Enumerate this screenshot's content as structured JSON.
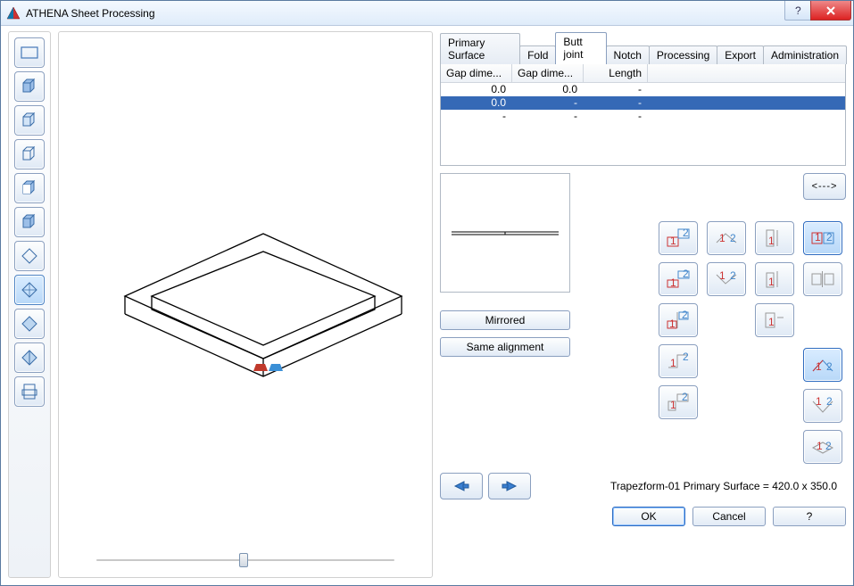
{
  "window": {
    "title": "ATHENA Sheet Processing"
  },
  "tabs": {
    "items": [
      {
        "label": "Primary Surface"
      },
      {
        "label": "Fold"
      },
      {
        "label": "Butt joint"
      },
      {
        "label": "Notch"
      },
      {
        "label": "Processing"
      },
      {
        "label": "Export"
      },
      {
        "label": "Administration"
      }
    ],
    "active": 2
  },
  "table": {
    "headers": {
      "c1": "Gap dime...",
      "c2": "Gap dime...",
      "c3": "Length"
    },
    "rows": [
      {
        "c1": "0.0",
        "c2": "0.0",
        "c3": "-"
      },
      {
        "c1": "0.0",
        "c2": "-",
        "c3": "-"
      },
      {
        "c1": "-",
        "c2": "-",
        "c3": "-"
      }
    ],
    "selected": 1
  },
  "buttons": {
    "mirrored": "Mirrored",
    "same_alignment": "Same alignment",
    "nav_swap": "<--->",
    "ok": "OK",
    "cancel": "Cancel",
    "help": "?"
  },
  "status": "Trapezform-01 Primary Surface = 420.0 x 350.0",
  "sidebar": {
    "items": [
      "primary-rect",
      "cube-front",
      "cube-side",
      "cube-top",
      "cube-angle",
      "cube-alt",
      "diamond",
      "diamond-notch",
      "prism",
      "prism2",
      "page"
    ],
    "selected": 7
  },
  "joint_icons": {
    "col1": [
      "j12-a",
      "j12-b",
      "j12-c",
      "j12-d",
      "j12-e"
    ],
    "col2": [
      "iso-a",
      "iso-b"
    ],
    "col3": [
      "edge-a",
      "edge-b",
      "edge-c"
    ],
    "col4": [
      "seam-a",
      "seam-b",
      "corner-a",
      "corner-b",
      "corner-c"
    ],
    "selected": [
      "seam-a",
      "corner-a"
    ]
  }
}
